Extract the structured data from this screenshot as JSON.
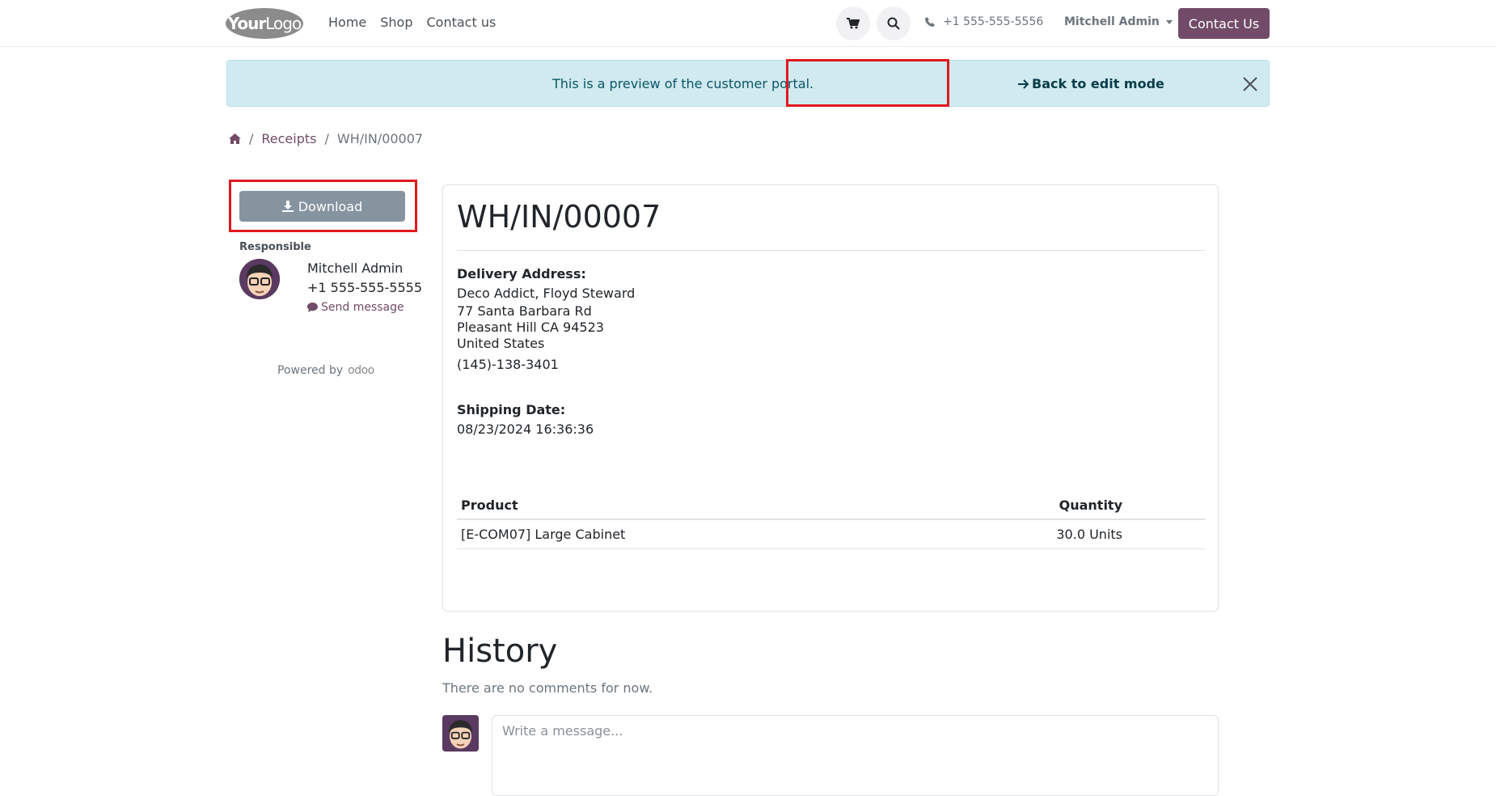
{
  "header": {
    "logo_bold": "Your",
    "logo_light": "Logo",
    "nav": [
      "Home",
      "Shop",
      "Contact us"
    ],
    "cart_icon": "cart-icon",
    "search_icon": "search-icon",
    "phone": "+1 555-555-5556",
    "user": "Mitchell Admin",
    "contact_button": "Contact Us"
  },
  "alert": {
    "text": "This is a preview of the customer portal.",
    "link": "Back to edit mode"
  },
  "breadcrumb": {
    "home_icon": "home-icon",
    "items": [
      "Receipts",
      "WH/IN/00007"
    ]
  },
  "sidebar": {
    "download": "Download",
    "responsible_title": "Responsible",
    "name": "Mitchell Admin",
    "phone": "+1 555-555-5555",
    "send_message": "Send message",
    "powered_by": "Powered by",
    "powered_brand": "odoo"
  },
  "document": {
    "title": "WH/IN/00007",
    "delivery_label": "Delivery Address:",
    "address": [
      "Deco Addict, Floyd Steward",
      "77 Santa Barbara Rd",
      "Pleasant Hill CA 94523",
      "United States"
    ],
    "phone": "(145)-138-3401",
    "shipping_label": "Shipping Date:",
    "shipping_date": "08/23/2024 16:36:36",
    "columns": [
      "Product",
      "Quantity"
    ],
    "rows": [
      [
        "[E-COM07] Large Cabinet",
        "30.0 Units"
      ]
    ]
  },
  "history": {
    "title": "History",
    "empty": "There are no comments for now.",
    "placeholder": "Write a message..."
  },
  "colors": {
    "brand": "#714b67",
    "alert_bg": "#d0eaf0",
    "highlight": "#e0191f"
  }
}
